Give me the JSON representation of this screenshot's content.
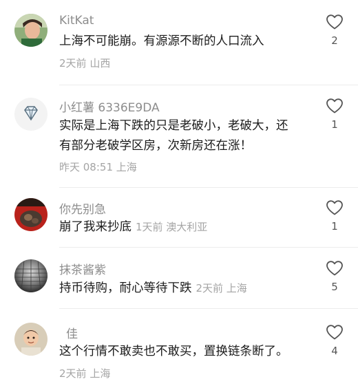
{
  "comments": [
    {
      "user": "KitKat",
      "text_lines": [
        "上海不可能崩。有源源不断的人口流入"
      ],
      "inline_meta": "",
      "time": "2天前",
      "location": "山西",
      "likes": "2",
      "avatar_icon": "photo-avatar-child"
    },
    {
      "user": "小红薯 6336E9DA",
      "text_lines": [
        "实际是上海下跌的只是老破小，老破大，还",
        "有部分老破学区房，次新房还在涨！"
      ],
      "inline_meta": "",
      "time": "昨天 08:51",
      "location": "上海",
      "likes": "1",
      "avatar_icon": "diamond-avatar"
    },
    {
      "user": "你先别急",
      "text_lines": [
        "崩了我来抄底"
      ],
      "inline_meta": "1天前 澳大利亚",
      "time": "",
      "location": "",
      "likes": "1",
      "avatar_icon": "photo-avatar-dark"
    },
    {
      "user": "抹茶酱紫",
      "text_lines": [
        "持币待购，耐心等待下跌"
      ],
      "inline_meta": "2天前 上海",
      "time": "",
      "location": "",
      "likes": "5",
      "avatar_icon": "photo-avatar-sphere"
    },
    {
      "user": "佳",
      "text_lines": [
        "这个行情不敢卖也不敢买，置换链条断了。"
      ],
      "inline_meta": "",
      "time": "2天前",
      "location": "上海",
      "likes": "4",
      "avatar_icon": "photo-avatar-baby"
    }
  ],
  "colors": {
    "username": "#8d8d8d",
    "text": "#1c1c1c",
    "meta": "#a4a4a4",
    "divider": "#ececec"
  }
}
